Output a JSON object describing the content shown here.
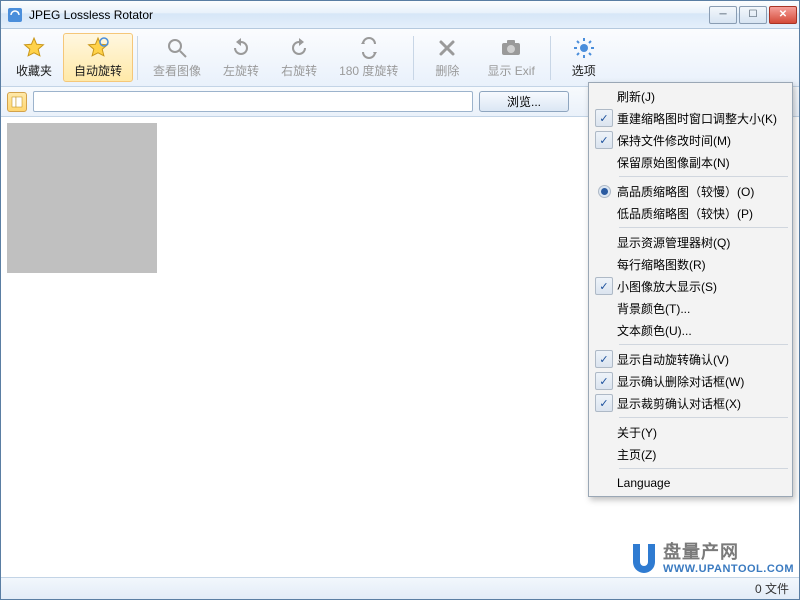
{
  "window": {
    "title": "JPEG Lossless Rotator"
  },
  "toolbar": {
    "favorites": "收藏夹",
    "autorotate": "自动旋转",
    "viewimage": "查看图像",
    "rotateleft": "左旋转",
    "rotateright": "右旋转",
    "rotate180": "180 度旋转",
    "delete": "删除",
    "showexif": "显示 Exif",
    "options": "选项"
  },
  "pathbar": {
    "browse": "浏览..."
  },
  "menu": {
    "refresh": "刷新(J)",
    "resize_rebuild": "重建缩略图时窗口调整大小(K)",
    "keep_mtime": "保持文件修改时间(M)",
    "keep_original": "保留原始图像副本(N)",
    "hq_thumb": "高品质缩略图（较慢）(O)",
    "lq_thumb": "低品质缩略图（较快）(P)",
    "show_tree": "显示资源管理器树(Q)",
    "thumbs_per_row": "每行缩略图数(R)",
    "enlarge_small": "小图像放大显示(S)",
    "bg_color": "背景颜色(T)...",
    "text_color": "文本颜色(U)...",
    "confirm_autorotate": "显示自动旋转确认(V)",
    "confirm_delete": "显示确认删除对话框(W)",
    "confirm_crop": "显示裁剪确认对话框(X)",
    "about": "关于(Y)",
    "homepage": "主页(Z)",
    "language": "Language"
  },
  "status": {
    "filecount": "0 文件"
  },
  "watermark": {
    "main": "盘量产网",
    "url": "WWW.UPANTOOL.COM"
  }
}
